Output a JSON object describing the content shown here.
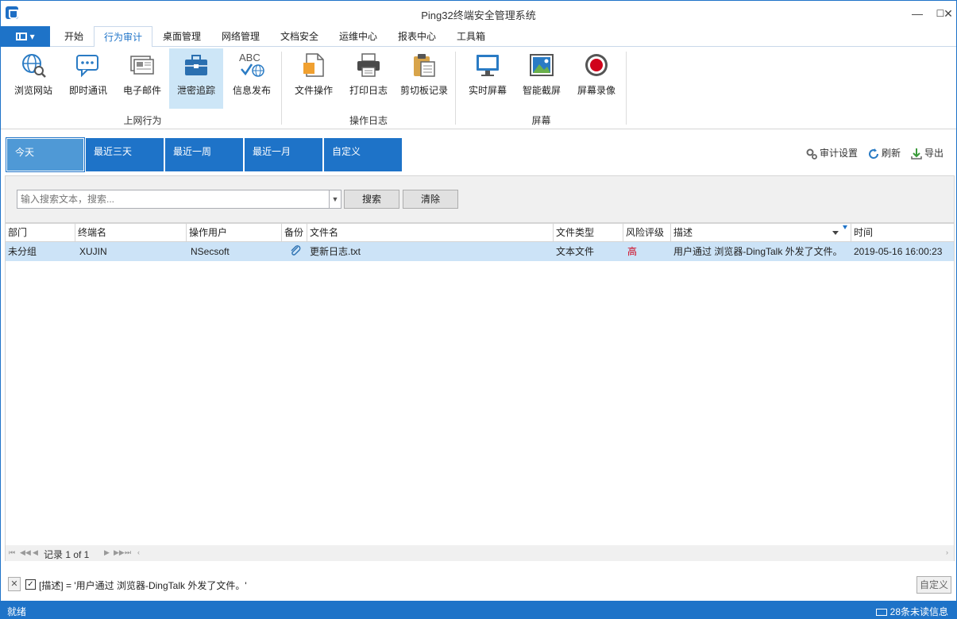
{
  "window": {
    "title": "Ping32终端安全管理系统",
    "min": "—",
    "max": "☐",
    "close": "✕"
  },
  "tabs": [
    "开始",
    "行为审计",
    "桌面管理",
    "网络管理",
    "文档安全",
    "运维中心",
    "报表中心",
    "工具箱"
  ],
  "active_tab": "行为审计",
  "ribbon": {
    "groups": [
      {
        "label": "上网行为",
        "buttons": [
          "浏览网站",
          "即时通讯",
          "电子邮件",
          "泄密追踪",
          "信息发布"
        ]
      },
      {
        "label": "操作日志",
        "buttons": [
          "文件操作",
          "打印日志",
          "剪切板记录"
        ]
      },
      {
        "label": "屏幕",
        "buttons": [
          "实时屏幕",
          "智能截屏",
          "屏幕录像"
        ]
      }
    ],
    "selected": "泄密追踪",
    "abc_text": "ABC"
  },
  "date_filters": [
    "今天",
    "最近三天",
    "最近一周",
    "最近一月",
    "自定义"
  ],
  "selected_date": "今天",
  "tools": {
    "audit_settings": "审计设置",
    "refresh": "刷新",
    "export": "导出"
  },
  "search": {
    "placeholder": "输入搜索文本，搜索...",
    "search_btn": "搜索",
    "clear_btn": "清除"
  },
  "grid": {
    "headers": [
      "部门",
      "终端名",
      "操作用户",
      "备份",
      "文件名",
      "文件类型",
      "风险评级",
      "描述",
      "时间"
    ],
    "rows": [
      {
        "dept": "未分组",
        "terminal": "XUJIN",
        "user": "NSecsoft",
        "backup": "📎",
        "filename": "更新日志.txt",
        "filetype": "文本文件",
        "risk": "高",
        "desc": "用户通过 浏览器-DingTalk 外发了文件。",
        "time": "2019-05-16 16:00:23"
      }
    ],
    "pager": "记录 1 of 1"
  },
  "filter_bar": {
    "close": "✕",
    "check": "✓",
    "text": "[描述] = '用户通过 浏览器-DingTalk 外发了文件。'",
    "custom": "自定义"
  },
  "status": {
    "left": "就绪",
    "right": "28条未读信息"
  },
  "colors": {
    "accent": "#1e73c8",
    "risk_high": "#d0021b",
    "row_selected": "#cce3f7"
  }
}
